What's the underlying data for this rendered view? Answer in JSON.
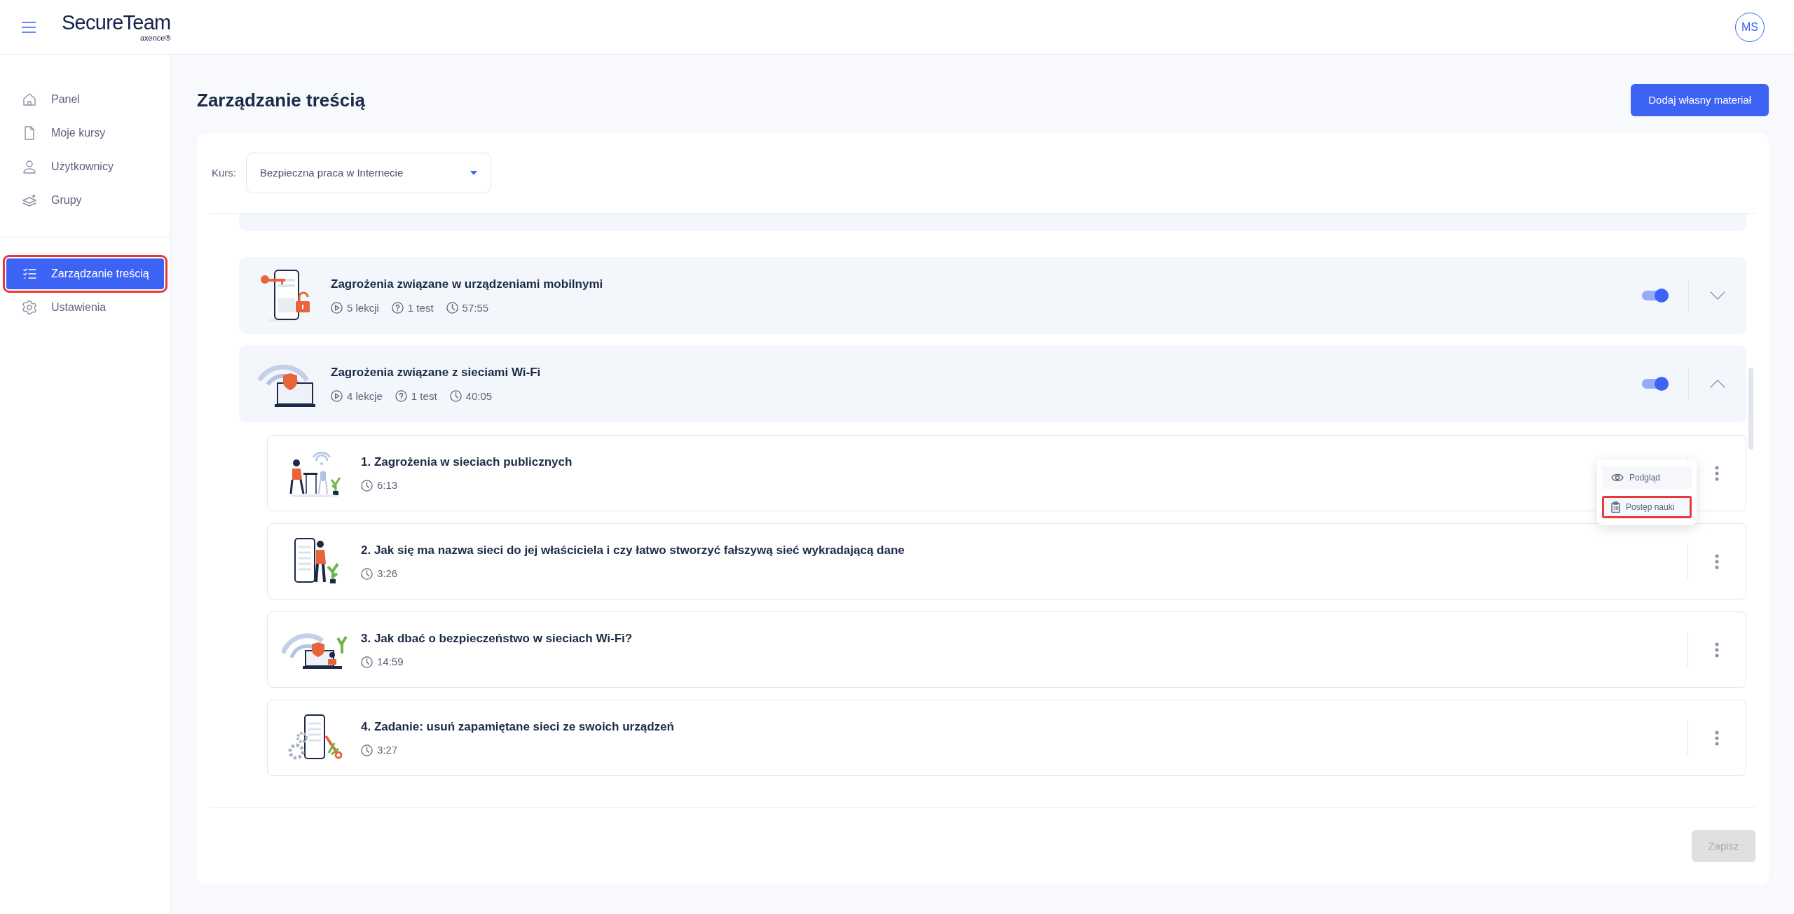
{
  "header": {
    "logo": "SecureTeam",
    "logo_sub": "axence®",
    "avatar": "MS"
  },
  "sidebar": {
    "sections": [
      {
        "items": [
          {
            "label": "Panel",
            "selected": false,
            "highlighted": false
          },
          {
            "label": "Moje kursy",
            "selected": false,
            "highlighted": false
          },
          {
            "label": "Użytkownicy",
            "selected": false,
            "highlighted": false
          },
          {
            "label": "Grupy",
            "selected": false,
            "highlighted": false
          }
        ]
      },
      {
        "items": [
          {
            "label": "Zarządzanie treścią",
            "selected": true,
            "highlighted": true
          },
          {
            "label": "Ustawienia",
            "selected": false,
            "highlighted": false
          }
        ]
      }
    ]
  },
  "page": {
    "title": "Zarządzanie treścią",
    "add_button": "Dodaj własny materiał"
  },
  "course_select": {
    "label": "Kurs:",
    "value": "Bezpieczna praca w Internecie"
  },
  "modules": [
    {
      "title": "Zagrożenia związane w urządzeniami mobilnymi",
      "lessons_count": "5 lekcji",
      "tests": "1 test",
      "duration": "57:55",
      "on": true,
      "expanded": false
    },
    {
      "title": "Zagrożenia związane z sieciami Wi-Fi",
      "lessons_count": "4 lekcje",
      "tests": "1 test",
      "duration": "40:05",
      "on": true,
      "expanded": true,
      "lessons": [
        {
          "title": "1. Zagrożenia w sieciach publicznych",
          "duration": "6:13",
          "menu": [
            {
              "label": "Podgląd",
              "highlighted": false
            },
            {
              "label": "Postęp nauki",
              "highlighted": true
            }
          ]
        },
        {
          "title": "2. Jak się ma nazwa sieci do jej właściciela i czy łatwo stworzyć fałszywą sieć wykradającą dane",
          "duration": "3:26"
        },
        {
          "title": "3. Jak dbać o bezpieczeństwo w sieciach Wi-Fi?",
          "duration": "14:59"
        },
        {
          "title": "4. Zadanie: usuń zapamiętane sieci ze swoich urządzeń",
          "duration": "3:27"
        }
      ]
    }
  ],
  "save_button": {
    "label": "Zapisz",
    "disabled": true
  }
}
